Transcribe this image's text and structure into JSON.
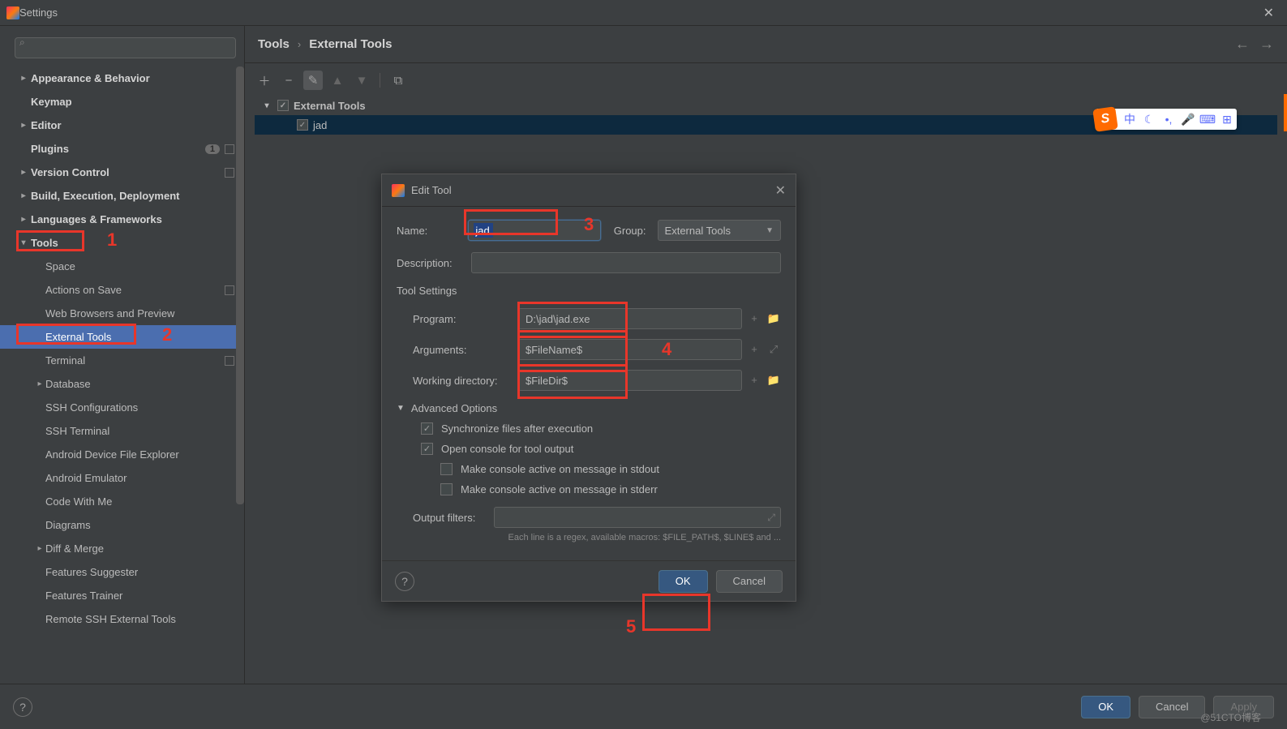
{
  "window": {
    "title": "Settings"
  },
  "search": {
    "placeholder": ""
  },
  "sidebar": {
    "appearance": "Appearance & Behavior",
    "keymap": "Keymap",
    "editor": "Editor",
    "plugins": "Plugins",
    "plugins_badge": "1",
    "version_control": "Version Control",
    "build": "Build, Execution, Deployment",
    "languages": "Languages & Frameworks",
    "tools": "Tools",
    "tools_children": {
      "space": "Space",
      "actions_on_save": "Actions on Save",
      "web_browsers": "Web Browsers and Preview",
      "external_tools": "External Tools",
      "terminal": "Terminal",
      "database": "Database",
      "ssh_configs": "SSH Configurations",
      "ssh_terminal": "SSH Terminal",
      "android_device": "Android Device File Explorer",
      "android_emulator": "Android Emulator",
      "code_with_me": "Code With Me",
      "diagrams": "Diagrams",
      "diff_merge": "Diff & Merge",
      "features_suggester": "Features Suggester",
      "features_trainer": "Features Trainer",
      "remote_ssh": "Remote SSH External Tools"
    }
  },
  "breadcrumb": {
    "root": "Tools",
    "leaf": "External Tools"
  },
  "ext_tree": {
    "root": "External Tools",
    "child": "jad"
  },
  "modal": {
    "title": "Edit Tool",
    "labels": {
      "name": "Name:",
      "group": "Group:",
      "description": "Description:",
      "tool_settings": "Tool Settings",
      "program": "Program:",
      "arguments": "Arguments:",
      "working_dir": "Working directory:",
      "advanced": "Advanced Options",
      "sync_files": "Synchronize files after execution",
      "open_console": "Open console for tool output",
      "console_stdout": "Make console active on message in stdout",
      "console_stderr": "Make console active on message in stderr",
      "output_filters": "Output filters:"
    },
    "values": {
      "name": "jad",
      "group": "External Tools",
      "description": "",
      "program": "D:\\jad\\jad.exe",
      "arguments": "$FileName$",
      "working_dir": "$FileDir$"
    },
    "checks": {
      "sync_files": true,
      "open_console": true,
      "console_stdout": false,
      "console_stderr": false
    },
    "hint": "Each line is a regex, available macros: $FILE_PATH$, $LINE$ and ...",
    "buttons": {
      "ok": "OK",
      "cancel": "Cancel"
    }
  },
  "footer": {
    "ok": "OK",
    "cancel": "Cancel",
    "apply": "Apply"
  },
  "ime": {
    "lang": "中"
  },
  "annotations": {
    "n1": "1",
    "n2": "2",
    "n3": "3",
    "n4": "4",
    "n5": "5"
  },
  "watermark": "@51CTO博客"
}
